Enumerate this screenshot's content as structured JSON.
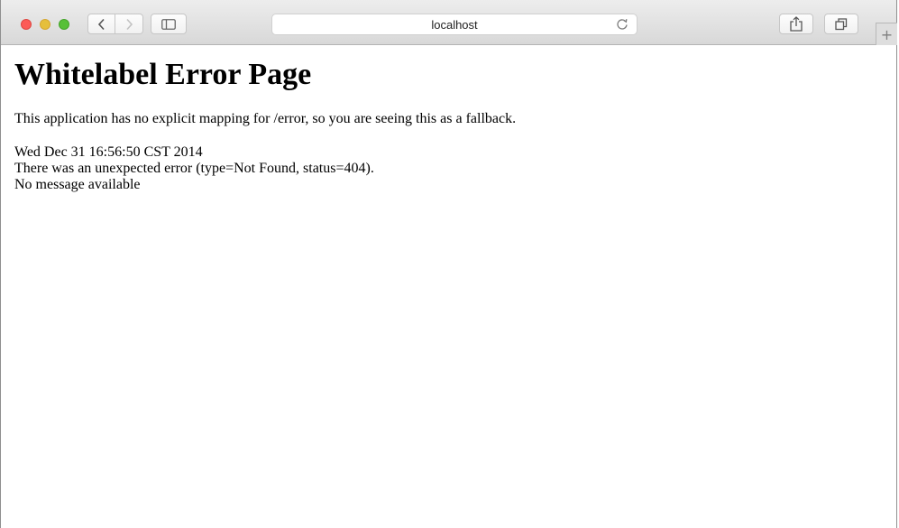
{
  "browser": {
    "address": "localhost",
    "icons": {
      "back": "chevron-left-icon",
      "forward": "chevron-right-icon",
      "sidebar": "sidebar-icon",
      "reload": "reload-icon",
      "share": "share-icon",
      "tabs": "tabs-overview-icon",
      "new_tab": "plus-icon"
    },
    "new_tab_label": "+",
    "traffic_colors": {
      "close": "#fc5b57",
      "minimize": "#e5bf3c",
      "maximize": "#57c038"
    }
  },
  "page": {
    "title": "Whitelabel Error Page",
    "description": "This application has no explicit mapping for /error, so you are seeing this as a fallback.",
    "timestamp": "Wed Dec 31 16:56:50 CST 2014",
    "error": "There was an unexpected error (type=Not Found, status=404).",
    "message": "No message available"
  }
}
